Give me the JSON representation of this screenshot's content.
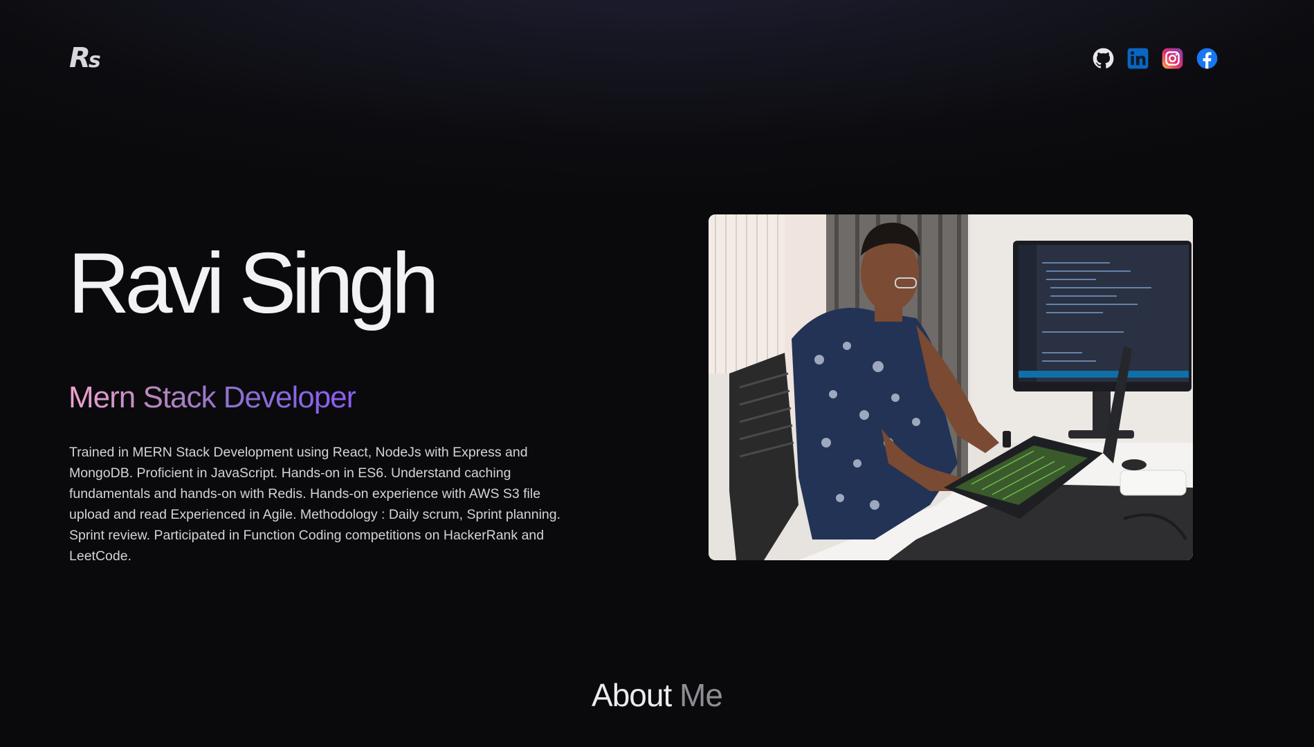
{
  "header": {
    "logo_main": "R",
    "logo_sub": "s",
    "socials": [
      {
        "name": "github",
        "icon": "github-icon",
        "color": "#e8e8ea"
      },
      {
        "name": "linkedin",
        "icon": "linkedin-icon",
        "color": "#0a66c2"
      },
      {
        "name": "instagram",
        "icon": "instagram-icon",
        "color": "#e1306c"
      },
      {
        "name": "facebook",
        "icon": "facebook-icon",
        "color": "#1877f2"
      }
    ]
  },
  "hero": {
    "name": "Ravi Singh",
    "role": "Mern Stack Developer",
    "description": "Trained in MERN Stack Development using React, NodeJs with Express and MongoDB. Proficient in JavaScript. Hands-on in ES6. Understand caching fundamentals and hands-on with Redis. Hands-on experience with AWS S3 file upload and read Experienced in Agile. Methodology : Daily scrum, Sprint planning. Sprint review. Participated in Function Coding competitions on HackerRank and LeetCode.",
    "photo_alt": "Ravi Singh working at a laptop"
  },
  "about": {
    "title_word1": "About",
    "title_word2": "Me"
  },
  "colors": {
    "background": "#0d0d11",
    "role_gradient_start": "#f3a3d0",
    "role_gradient_end": "#8b5cf6"
  }
}
